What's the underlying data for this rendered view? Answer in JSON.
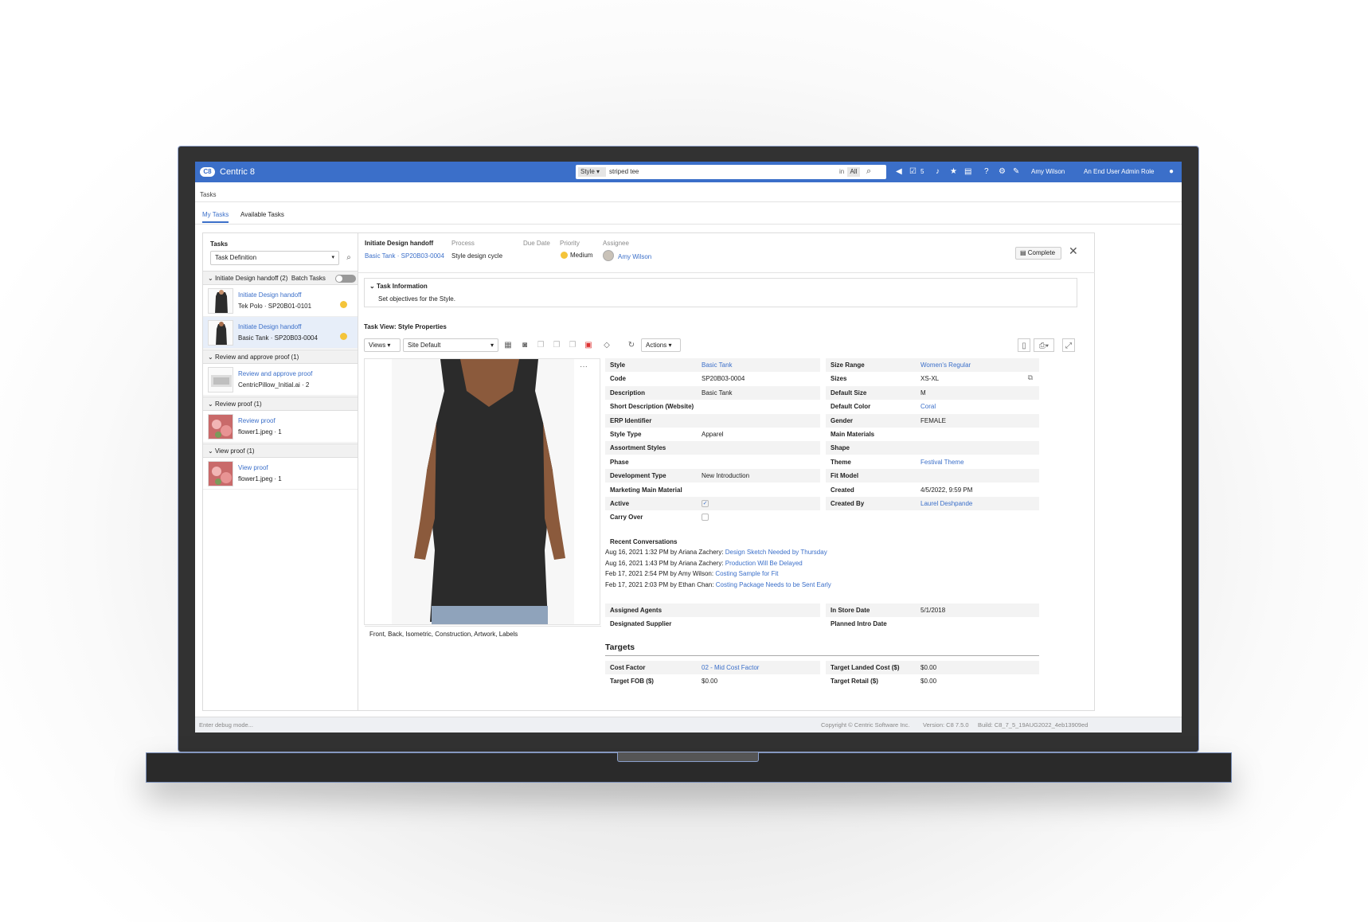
{
  "app": {
    "title": "Centric 8",
    "logo": "C8"
  },
  "search": {
    "scope": "Style",
    "query": "striped tee",
    "in_label": "in",
    "in_value": "All"
  },
  "topbar": {
    "notification_count": "5",
    "user": "Amy Wilson",
    "role": "An End User Admin Role"
  },
  "breadcrumb": "Tasks",
  "tabs": [
    {
      "label": "My Tasks"
    },
    {
      "label": "Available Tasks"
    }
  ],
  "left": {
    "title": "Tasks",
    "filter": "Task Definition",
    "groups": [
      {
        "label": "Initiate Design handoff (2)",
        "batch_label": "Batch Tasks",
        "items": [
          {
            "link": "Initiate Design handoff",
            "sub": "Tek Polo · SP20B01-0101"
          },
          {
            "link": "Initiate Design handoff",
            "sub": "Basic Tank · SP20B03-0004"
          }
        ]
      },
      {
        "label": "Review and approve proof (1)",
        "items": [
          {
            "link": "Review and approve proof",
            "sub": "CentricPillow_Initial.ai · 2"
          }
        ]
      },
      {
        "label": "Review proof (1)",
        "items": [
          {
            "link": "Review proof",
            "sub": "flower1.jpeg · 1"
          }
        ]
      },
      {
        "label": "View proof (1)",
        "items": [
          {
            "link": "View proof",
            "sub": "flower1.jpeg · 1"
          }
        ]
      }
    ]
  },
  "task": {
    "name": "Initiate Design handoff",
    "link": "Basic Tank · SP20B03-0004",
    "process_label": "Process",
    "process": "Style design cycle",
    "due_label": "Due Date",
    "priority_label": "Priority",
    "priority": "Medium",
    "assignee_label": "Assignee",
    "assignee": "Amy Wilson",
    "complete_label": "Complete",
    "info_title": "Task Information",
    "info_text": "Set objectives for the Style.",
    "view_label": "Task View:",
    "view_name": "Style Properties"
  },
  "toolbar": {
    "views": "Views",
    "site": "Site Default",
    "actions": "Actions"
  },
  "image": {
    "caption": "Front, Back, Isometric, Construction, Artwork, Labels"
  },
  "props_left": [
    {
      "label": "Style",
      "value": "Basic Tank",
      "link": true
    },
    {
      "label": "Code",
      "value": "SP20B03-0004"
    },
    {
      "label": "Description",
      "value": "Basic Tank"
    },
    {
      "label": "Short Description (Website)",
      "value": ""
    },
    {
      "label": "ERP Identifier",
      "value": ""
    },
    {
      "label": "Style Type",
      "value": "Apparel"
    },
    {
      "label": "Assortment Styles",
      "value": ""
    },
    {
      "label": "Phase",
      "value": ""
    },
    {
      "label": "Development Type",
      "value": "New Introduction"
    },
    {
      "label": "Marketing Main Material",
      "value": ""
    },
    {
      "label": "Active",
      "value": ""
    },
    {
      "label": "Carry Over",
      "value": ""
    }
  ],
  "props_right": [
    {
      "label": "Size Range",
      "value": "Women's Regular",
      "link": true
    },
    {
      "label": "Sizes",
      "value": "XS-XL"
    },
    {
      "label": "Default Size",
      "value": "M"
    },
    {
      "label": "Default Color",
      "value": "Coral",
      "link": true
    },
    {
      "label": "Gender",
      "value": "FEMALE"
    },
    {
      "label": "Main Materials",
      "value": ""
    },
    {
      "label": "Shape",
      "value": ""
    },
    {
      "label": "Theme",
      "value": "Festival Theme",
      "link": true
    },
    {
      "label": "Fit Model",
      "value": ""
    },
    {
      "label": "Created",
      "value": "4/5/2022, 9:59 PM"
    },
    {
      "label": "Created By",
      "value": "Laurel Deshpande",
      "link": true
    }
  ],
  "conversations": {
    "title": "Recent Conversations",
    "items": [
      {
        "meta": "Aug 16, 2021 1:32 PM by Ariana Zachery:",
        "link": "Design Sketch Needed by Thursday"
      },
      {
        "meta": "Aug 16, 2021 1:43 PM by Ariana Zachery:",
        "link": "Production Will Be Delayed"
      },
      {
        "meta": "Feb 17, 2021 2:54 PM by Amy Wilson:",
        "link": "Costing Sample for Fit"
      },
      {
        "meta": "Feb 17, 2021 2:03 PM by Ethan Chan:",
        "link": "Costing Package Needs to be Sent Early"
      }
    ]
  },
  "agents": [
    {
      "label": "Assigned Agents",
      "value": ""
    },
    {
      "label": "Designated Supplier",
      "value": ""
    }
  ],
  "dates": [
    {
      "label": "In Store Date",
      "value": "5/1/2018"
    },
    {
      "label": "Planned Intro Date",
      "value": ""
    }
  ],
  "targets": {
    "title": "Targets",
    "left": [
      {
        "label": "Cost Factor",
        "value": "02 - Mid Cost Factor",
        "link": true
      },
      {
        "label": "Target FOB ($)",
        "value": "$0.00"
      }
    ],
    "right": [
      {
        "label": "Target Landed Cost ($)",
        "value": "$0.00"
      },
      {
        "label": "Target Retail ($)",
        "value": "$0.00"
      }
    ]
  },
  "footer": {
    "debug": "Enter debug mode...",
    "copyright": "Copyright © Centric Software Inc.",
    "version": "Version: C8 7.5.0",
    "build": "Build: C8_7_5_19AUG2022_4eb13909ed"
  }
}
